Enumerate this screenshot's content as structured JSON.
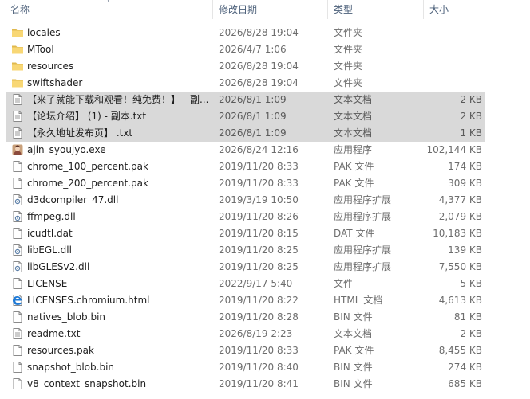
{
  "columns": {
    "name": "名称",
    "date": "修改日期",
    "type": "类型",
    "size": "大小"
  },
  "files": [
    {
      "name": "locales",
      "date": "2026/8/28 19:04",
      "type": "文件夹",
      "size": "",
      "icon": "folder-icon",
      "selected": false
    },
    {
      "name": "MTool",
      "date": "2026/4/7 1:06",
      "type": "文件夹",
      "size": "",
      "icon": "folder-icon",
      "selected": false
    },
    {
      "name": "resources",
      "date": "2026/8/28 19:04",
      "type": "文件夹",
      "size": "",
      "icon": "folder-icon",
      "selected": false
    },
    {
      "name": "swiftshader",
      "date": "2026/8/28 19:04",
      "type": "文件夹",
      "size": "",
      "icon": "folder-icon",
      "selected": false
    },
    {
      "name": "【来了就能下载和观看！纯免费！】 - 副...",
      "date": "2026/8/1 1:09",
      "type": "文本文档",
      "size": "2 KB",
      "icon": "text-file-icon",
      "selected": true
    },
    {
      "name": "【论坛介绍】 (1) - 副本.txt",
      "date": "2026/8/1 1:09",
      "type": "文本文档",
      "size": "2 KB",
      "icon": "text-file-icon",
      "selected": true
    },
    {
      "name": "【永久地址发布页】 .txt",
      "date": "2026/8/1 1:09",
      "type": "文本文档",
      "size": "1 KB",
      "icon": "text-file-icon",
      "selected": true
    },
    {
      "name": "ajin_syoujyo.exe",
      "date": "2026/8/24 12:16",
      "type": "应用程序",
      "size": "102,144 KB",
      "icon": "app-exe-icon",
      "selected": false
    },
    {
      "name": "chrome_100_percent.pak",
      "date": "2019/11/20 8:33",
      "type": "PAK 文件",
      "size": "174 KB",
      "icon": "file-icon",
      "selected": false
    },
    {
      "name": "chrome_200_percent.pak",
      "date": "2019/11/20 8:33",
      "type": "PAK 文件",
      "size": "309 KB",
      "icon": "file-icon",
      "selected": false
    },
    {
      "name": "d3dcompiler_47.dll",
      "date": "2019/3/19 10:50",
      "type": "应用程序扩展",
      "size": "4,377 KB",
      "icon": "dll-file-icon",
      "selected": false
    },
    {
      "name": "ffmpeg.dll",
      "date": "2019/11/20 8:26",
      "type": "应用程序扩展",
      "size": "2,079 KB",
      "icon": "dll-file-icon",
      "selected": false
    },
    {
      "name": "icudtl.dat",
      "date": "2019/11/20 8:15",
      "type": "DAT 文件",
      "size": "10,183 KB",
      "icon": "file-icon",
      "selected": false
    },
    {
      "name": "libEGL.dll",
      "date": "2019/11/20 8:25",
      "type": "应用程序扩展",
      "size": "139 KB",
      "icon": "dll-file-icon",
      "selected": false
    },
    {
      "name": "libGLESv2.dll",
      "date": "2019/11/20 8:25",
      "type": "应用程序扩展",
      "size": "7,550 KB",
      "icon": "dll-file-icon",
      "selected": false
    },
    {
      "name": "LICENSE",
      "date": "2022/9/17 5:40",
      "type": "文件",
      "size": "5 KB",
      "icon": "file-icon",
      "selected": false
    },
    {
      "name": "LICENSES.chromium.html",
      "date": "2019/11/20 8:22",
      "type": "HTML 文档",
      "size": "4,613 KB",
      "icon": "edge-html-icon",
      "selected": false
    },
    {
      "name": "natives_blob.bin",
      "date": "2019/11/20 8:28",
      "type": "BIN 文件",
      "size": "81 KB",
      "icon": "file-icon",
      "selected": false
    },
    {
      "name": "readme.txt",
      "date": "2026/8/19 2:23",
      "type": "文本文档",
      "size": "2 KB",
      "icon": "text-file-icon",
      "selected": false
    },
    {
      "name": "resources.pak",
      "date": "2019/11/20 8:33",
      "type": "PAK 文件",
      "size": "8,455 KB",
      "icon": "file-icon",
      "selected": false
    },
    {
      "name": "snapshot_blob.bin",
      "date": "2019/11/20 8:40",
      "type": "BIN 文件",
      "size": "274 KB",
      "icon": "file-icon",
      "selected": false
    },
    {
      "name": "v8_context_snapshot.bin",
      "date": "2019/11/20 8:41",
      "type": "BIN 文件",
      "size": "685 KB",
      "icon": "file-icon",
      "selected": false
    }
  ],
  "colors": {
    "header_text": "#4c607a",
    "selection": "#d9d9d9",
    "folder": "#f8d775",
    "folder_dark": "#e0b94e"
  }
}
